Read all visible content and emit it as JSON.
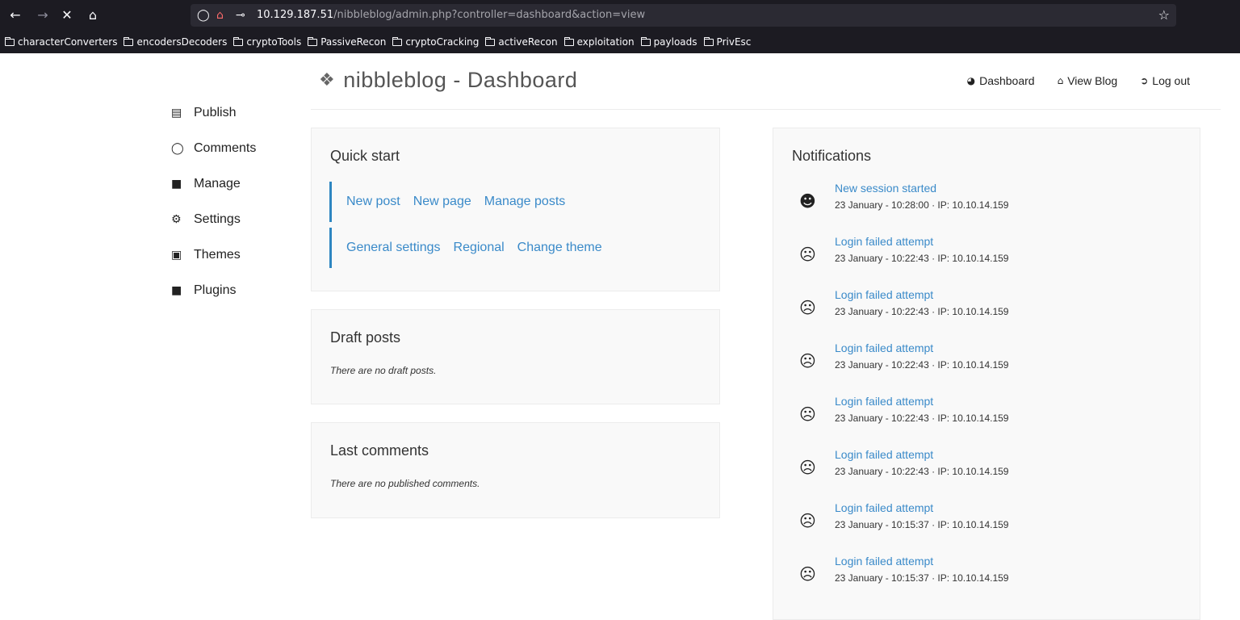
{
  "browser": {
    "url_host": "10.129.187.51",
    "url_path": "/nibbleblog/admin.php?controller=dashboard&action=view",
    "bookmarks": [
      "characterConverters",
      "encodersDecoders",
      "cryptoTools",
      "PassiveRecon",
      "cryptoCracking",
      "activeRecon",
      "exploitation",
      "payloads",
      "PrivEsc"
    ]
  },
  "brand": {
    "title": "nibbleblog - Dashboard"
  },
  "topnav": {
    "dashboard": "Dashboard",
    "view_blog": "View Blog",
    "logout": "Log out"
  },
  "sidebar": {
    "items": [
      {
        "label": "Publish",
        "icon": "publish-icon"
      },
      {
        "label": "Comments",
        "icon": "comment-icon"
      },
      {
        "label": "Manage",
        "icon": "folder-icon"
      },
      {
        "label": "Settings",
        "icon": "gear-icon"
      },
      {
        "label": "Themes",
        "icon": "image-icon"
      },
      {
        "label": "Plugins",
        "icon": "folder-icon"
      }
    ]
  },
  "quick_start": {
    "title": "Quick start",
    "row1": [
      "New post",
      "New page",
      "Manage posts"
    ],
    "row2": [
      "General settings",
      "Regional",
      "Change theme"
    ]
  },
  "draft_posts": {
    "title": "Draft posts",
    "empty": "There are no draft posts."
  },
  "last_comments": {
    "title": "Last comments",
    "empty": "There are no published comments."
  },
  "notifications": {
    "title": "Notifications",
    "items": [
      {
        "title": "New session started",
        "meta": "23 January - 10:28:00 · IP: 10.10.14.159",
        "icon": "user-icon"
      },
      {
        "title": "Login failed attempt",
        "meta": "23 January - 10:22:43 · IP: 10.10.14.159",
        "icon": "frown-icon"
      },
      {
        "title": "Login failed attempt",
        "meta": "23 January - 10:22:43 · IP: 10.10.14.159",
        "icon": "frown-icon"
      },
      {
        "title": "Login failed attempt",
        "meta": "23 January - 10:22:43 · IP: 10.10.14.159",
        "icon": "frown-icon"
      },
      {
        "title": "Login failed attempt",
        "meta": "23 January - 10:22:43 · IP: 10.10.14.159",
        "icon": "frown-icon"
      },
      {
        "title": "Login failed attempt",
        "meta": "23 January - 10:22:43 · IP: 10.10.14.159",
        "icon": "frown-icon"
      },
      {
        "title": "Login failed attempt",
        "meta": "23 January - 10:15:37 · IP: 10.10.14.159",
        "icon": "frown-icon"
      },
      {
        "title": "Login failed attempt",
        "meta": "23 January - 10:15:37 · IP: 10.10.14.159",
        "icon": "frown-icon"
      }
    ]
  }
}
